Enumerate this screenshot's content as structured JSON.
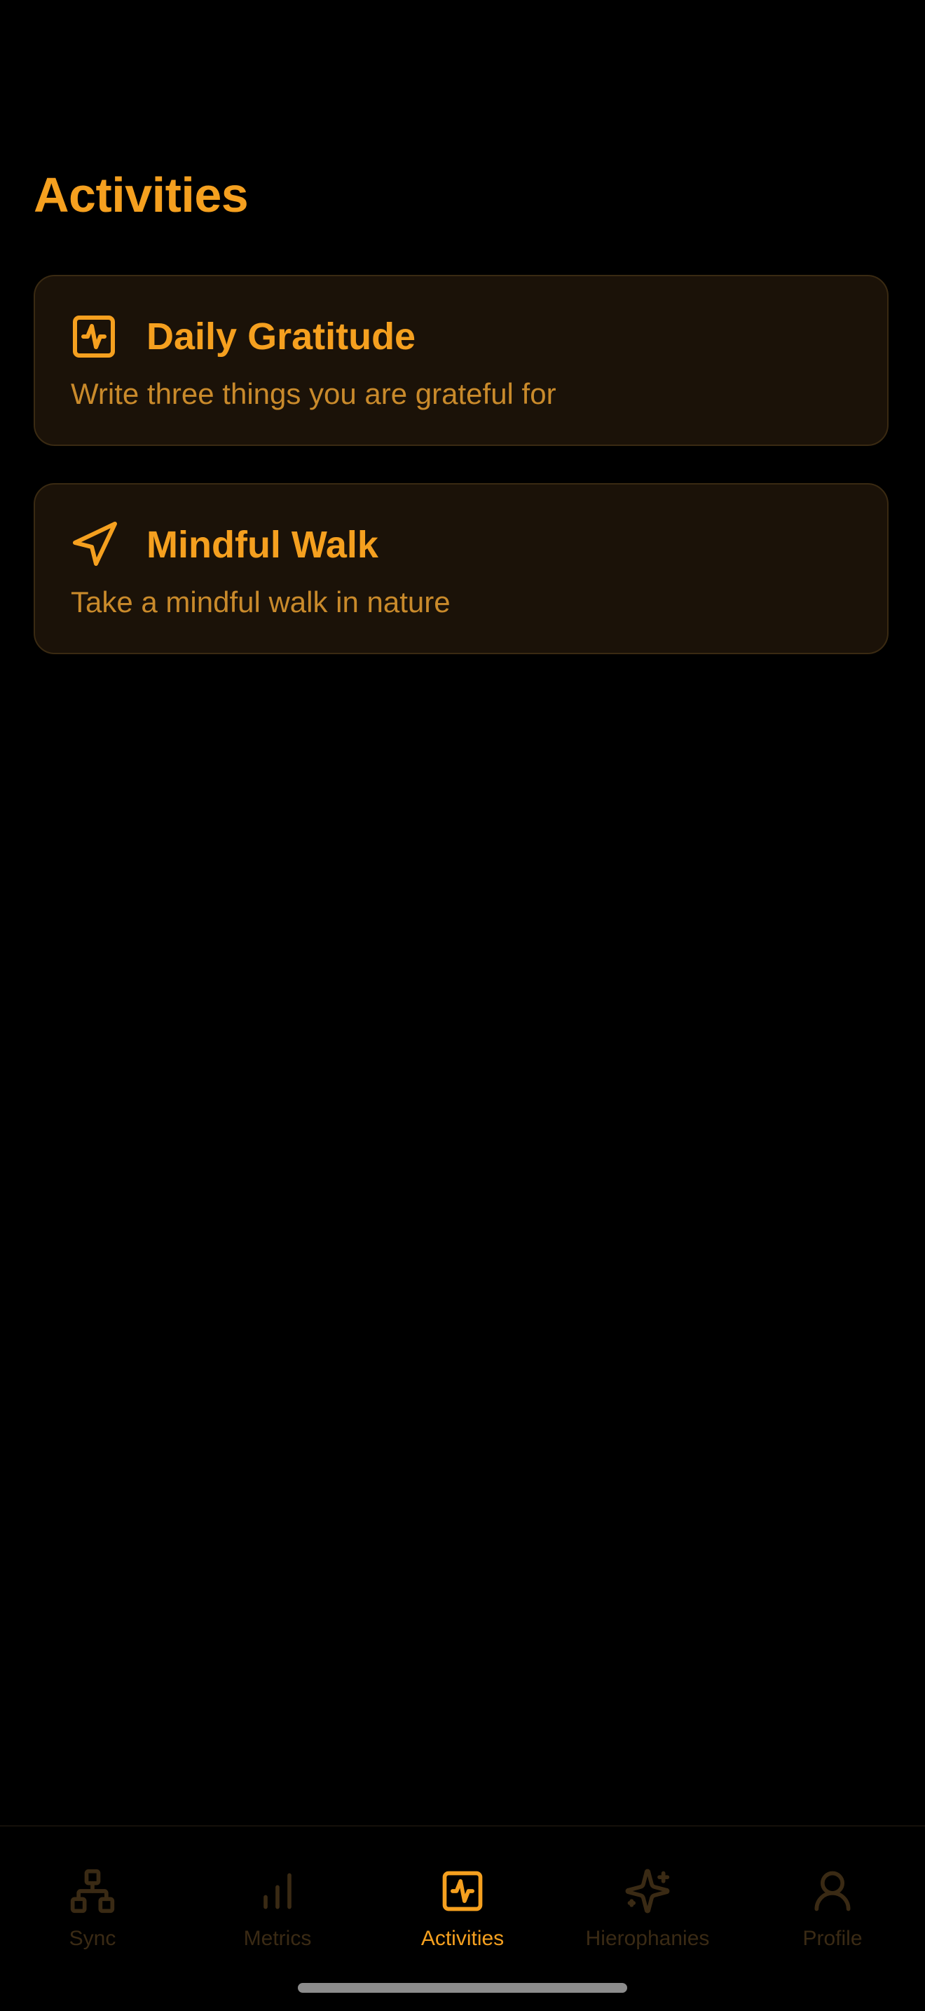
{
  "header": {
    "title": "Activities"
  },
  "activities": [
    {
      "title": "Daily Gratitude",
      "description": "Write three things you are grateful for",
      "icon": "activity-square-icon"
    },
    {
      "title": "Mindful Walk",
      "description": "Take a mindful walk in nature",
      "icon": "navigation-arrow-icon"
    }
  ],
  "tabbar": {
    "active": "Activities",
    "tabs": [
      {
        "label": "Sync",
        "icon": "network-sync-icon"
      },
      {
        "label": "Metrics",
        "icon": "bar-chart-icon"
      },
      {
        "label": "Activities",
        "icon": "activity-square-icon"
      },
      {
        "label": "Hierophanies",
        "icon": "sparkles-icon"
      },
      {
        "label": "Profile",
        "icon": "person-icon"
      }
    ]
  },
  "colors": {
    "background": "#000000",
    "accent": "#F5A01F",
    "card_background": "#1B1208",
    "card_border": "#3A2A12",
    "description": "#C98A2B",
    "inactive_tab": "#3A2A14"
  }
}
